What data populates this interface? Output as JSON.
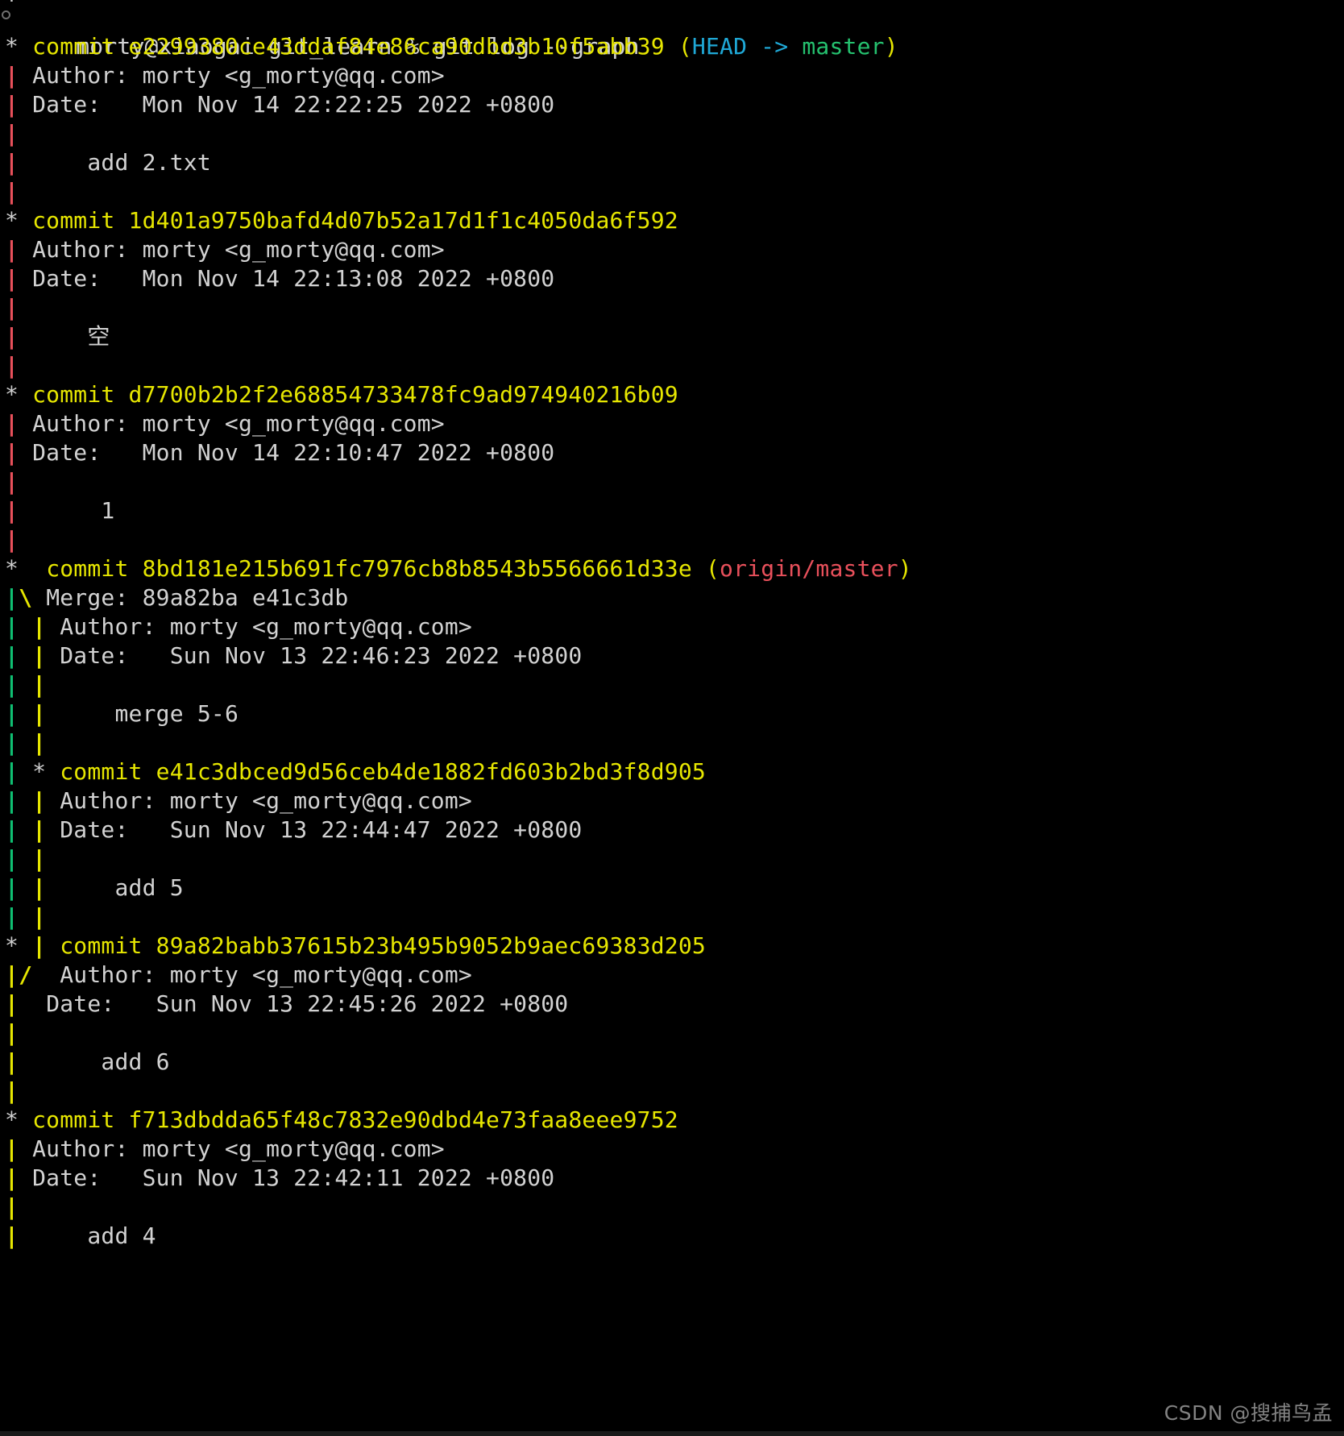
{
  "terminal": {
    "background_color": "#000000",
    "foreground_color": "#d2d2d2",
    "top_partial_line": "|",
    "prompt": {
      "bullet_icon": "circle-bullet-icon",
      "text": "morty@xiaogai git_learn % git log --graph"
    },
    "colors": {
      "commit_hash": "#e6e600",
      "head_ref": "#1fa8d6",
      "branch_ref": "#25c16f",
      "remote_ref": "#e8505b",
      "graph_red": "#e8505b",
      "graph_green": "#0fbf72",
      "graph_yellow": "#e6e600",
      "text": "#d2d2d2"
    }
  },
  "lines": [
    {
      "gutter": [
        {
          "t": "*",
          "c": "star"
        },
        {
          "t": " ",
          "c": "txt"
        }
      ],
      "segments": [
        {
          "t": "commit e2299380ce43ddaf84e86ca90dbd3b10f5abb39 ",
          "c": "yellow"
        },
        {
          "t": "(",
          "c": "yellow"
        },
        {
          "t": "HEAD -> ",
          "c": "cyan"
        },
        {
          "t": "master",
          "c": "green"
        },
        {
          "t": ")",
          "c": "yellow"
        }
      ]
    },
    {
      "gutter": [
        {
          "t": "|",
          "c": "g-red"
        },
        {
          "t": " ",
          "c": "txt"
        }
      ],
      "segments": [
        {
          "t": "Author: morty <g_morty@qq.com>",
          "c": "txt"
        }
      ]
    },
    {
      "gutter": [
        {
          "t": "|",
          "c": "g-red"
        },
        {
          "t": " ",
          "c": "txt"
        }
      ],
      "segments": [
        {
          "t": "Date:   Mon Nov 14 22:22:25 2022 +0800",
          "c": "txt"
        }
      ]
    },
    {
      "gutter": [
        {
          "t": "|",
          "c": "g-red"
        },
        {
          "t": " ",
          "c": "txt"
        }
      ],
      "segments": [
        {
          "t": "",
          "c": "txt"
        }
      ]
    },
    {
      "gutter": [
        {
          "t": "|",
          "c": "g-red"
        },
        {
          "t": " ",
          "c": "txt"
        }
      ],
      "segments": [
        {
          "t": "    add 2.txt",
          "c": "txt"
        }
      ]
    },
    {
      "gutter": [
        {
          "t": "|",
          "c": "g-red"
        },
        {
          "t": " ",
          "c": "txt"
        }
      ],
      "segments": [
        {
          "t": "",
          "c": "txt"
        }
      ]
    },
    {
      "gutter": [
        {
          "t": "*",
          "c": "star"
        },
        {
          "t": " ",
          "c": "txt"
        }
      ],
      "segments": [
        {
          "t": "commit 1d401a9750bafd4d07b52a17d1f1c4050da6f592",
          "c": "yellow"
        }
      ]
    },
    {
      "gutter": [
        {
          "t": "|",
          "c": "g-red"
        },
        {
          "t": " ",
          "c": "txt"
        }
      ],
      "segments": [
        {
          "t": "Author: morty <g_morty@qq.com>",
          "c": "txt"
        }
      ]
    },
    {
      "gutter": [
        {
          "t": "|",
          "c": "g-red"
        },
        {
          "t": " ",
          "c": "txt"
        }
      ],
      "segments": [
        {
          "t": "Date:   Mon Nov 14 22:13:08 2022 +0800",
          "c": "txt"
        }
      ]
    },
    {
      "gutter": [
        {
          "t": "|",
          "c": "g-red"
        },
        {
          "t": " ",
          "c": "txt"
        }
      ],
      "segments": [
        {
          "t": "",
          "c": "txt"
        }
      ]
    },
    {
      "gutter": [
        {
          "t": "|",
          "c": "g-red"
        },
        {
          "t": " ",
          "c": "txt"
        }
      ],
      "segments": [
        {
          "t": "    空",
          "c": "txt"
        }
      ]
    },
    {
      "gutter": [
        {
          "t": "|",
          "c": "g-red"
        },
        {
          "t": " ",
          "c": "txt"
        }
      ],
      "segments": [
        {
          "t": "",
          "c": "txt"
        }
      ]
    },
    {
      "gutter": [
        {
          "t": "*",
          "c": "star"
        },
        {
          "t": " ",
          "c": "txt"
        }
      ],
      "segments": [
        {
          "t": "commit d7700b2b2f2e68854733478fc9ad974940216b09",
          "c": "yellow"
        }
      ]
    },
    {
      "gutter": [
        {
          "t": "|",
          "c": "g-red"
        },
        {
          "t": " ",
          "c": "txt"
        }
      ],
      "segments": [
        {
          "t": "Author: morty <g_morty@qq.com>",
          "c": "txt"
        }
      ]
    },
    {
      "gutter": [
        {
          "t": "|",
          "c": "g-red"
        },
        {
          "t": " ",
          "c": "txt"
        }
      ],
      "segments": [
        {
          "t": "Date:   Mon Nov 14 22:10:47 2022 +0800",
          "c": "txt"
        }
      ]
    },
    {
      "gutter": [
        {
          "t": "|",
          "c": "g-red"
        },
        {
          "t": " ",
          "c": "txt"
        }
      ],
      "segments": [
        {
          "t": "",
          "c": "txt"
        }
      ]
    },
    {
      "gutter": [
        {
          "t": "|",
          "c": "g-red"
        },
        {
          "t": " ",
          "c": "txt"
        }
      ],
      "segments": [
        {
          "t": "     1",
          "c": "txt"
        }
      ]
    },
    {
      "gutter": [
        {
          "t": "|",
          "c": "g-red"
        },
        {
          "t": " ",
          "c": "txt"
        }
      ],
      "segments": [
        {
          "t": "",
          "c": "txt"
        }
      ]
    },
    {
      "gutter": [
        {
          "t": "*",
          "c": "star"
        },
        {
          "t": "  ",
          "c": "txt"
        }
      ],
      "segments": [
        {
          "t": "commit 8bd181e215b691fc7976cb8b8543b5566661d33e ",
          "c": "yellow"
        },
        {
          "t": "(",
          "c": "yellow"
        },
        {
          "t": "origin/master",
          "c": "red"
        },
        {
          "t": ")",
          "c": "yellow"
        }
      ]
    },
    {
      "gutter": [
        {
          "t": "|",
          "c": "g-green"
        },
        {
          "t": "\\",
          "c": "g-yellow"
        },
        {
          "t": " ",
          "c": "txt"
        }
      ],
      "segments": [
        {
          "t": "Merge: 89a82ba e41c3db",
          "c": "txt"
        }
      ]
    },
    {
      "gutter": [
        {
          "t": "|",
          "c": "g-green"
        },
        {
          "t": " ",
          "c": "txt"
        },
        {
          "t": "|",
          "c": "g-yellow"
        },
        {
          "t": " ",
          "c": "txt"
        }
      ],
      "segments": [
        {
          "t": "Author: morty <g_morty@qq.com>",
          "c": "txt"
        }
      ]
    },
    {
      "gutter": [
        {
          "t": "|",
          "c": "g-green"
        },
        {
          "t": " ",
          "c": "txt"
        },
        {
          "t": "|",
          "c": "g-yellow"
        },
        {
          "t": " ",
          "c": "txt"
        }
      ],
      "segments": [
        {
          "t": "Date:   Sun Nov 13 22:46:23 2022 +0800",
          "c": "txt"
        }
      ]
    },
    {
      "gutter": [
        {
          "t": "|",
          "c": "g-green"
        },
        {
          "t": " ",
          "c": "txt"
        },
        {
          "t": "|",
          "c": "g-yellow"
        },
        {
          "t": " ",
          "c": "txt"
        }
      ],
      "segments": [
        {
          "t": "",
          "c": "txt"
        }
      ]
    },
    {
      "gutter": [
        {
          "t": "|",
          "c": "g-green"
        },
        {
          "t": " ",
          "c": "txt"
        },
        {
          "t": "|",
          "c": "g-yellow"
        },
        {
          "t": " ",
          "c": "txt"
        }
      ],
      "segments": [
        {
          "t": "    merge 5-6",
          "c": "txt"
        }
      ]
    },
    {
      "gutter": [
        {
          "t": "|",
          "c": "g-green"
        },
        {
          "t": " ",
          "c": "txt"
        },
        {
          "t": "|",
          "c": "g-yellow"
        },
        {
          "t": " ",
          "c": "txt"
        }
      ],
      "segments": [
        {
          "t": "",
          "c": "txt"
        }
      ]
    },
    {
      "gutter": [
        {
          "t": "|",
          "c": "g-green"
        },
        {
          "t": " ",
          "c": "txt"
        },
        {
          "t": "*",
          "c": "star"
        },
        {
          "t": " ",
          "c": "txt"
        }
      ],
      "segments": [
        {
          "t": "commit e41c3dbced9d56ceb4de1882fd603b2bd3f8d905",
          "c": "yellow"
        }
      ]
    },
    {
      "gutter": [
        {
          "t": "|",
          "c": "g-green"
        },
        {
          "t": " ",
          "c": "txt"
        },
        {
          "t": "|",
          "c": "g-yellow"
        },
        {
          "t": " ",
          "c": "txt"
        }
      ],
      "segments": [
        {
          "t": "Author: morty <g_morty@qq.com>",
          "c": "txt"
        }
      ]
    },
    {
      "gutter": [
        {
          "t": "|",
          "c": "g-green"
        },
        {
          "t": " ",
          "c": "txt"
        },
        {
          "t": "|",
          "c": "g-yellow"
        },
        {
          "t": " ",
          "c": "txt"
        }
      ],
      "segments": [
        {
          "t": "Date:   Sun Nov 13 22:44:47 2022 +0800",
          "c": "txt"
        }
      ]
    },
    {
      "gutter": [
        {
          "t": "|",
          "c": "g-green"
        },
        {
          "t": " ",
          "c": "txt"
        },
        {
          "t": "|",
          "c": "g-yellow"
        },
        {
          "t": " ",
          "c": "txt"
        }
      ],
      "segments": [
        {
          "t": "",
          "c": "txt"
        }
      ]
    },
    {
      "gutter": [
        {
          "t": "|",
          "c": "g-green"
        },
        {
          "t": " ",
          "c": "txt"
        },
        {
          "t": "|",
          "c": "g-yellow"
        },
        {
          "t": " ",
          "c": "txt"
        }
      ],
      "segments": [
        {
          "t": "    add 5",
          "c": "txt"
        }
      ]
    },
    {
      "gutter": [
        {
          "t": "|",
          "c": "g-green"
        },
        {
          "t": " ",
          "c": "txt"
        },
        {
          "t": "|",
          "c": "g-yellow"
        },
        {
          "t": " ",
          "c": "txt"
        }
      ],
      "segments": [
        {
          "t": "",
          "c": "txt"
        }
      ]
    },
    {
      "gutter": [
        {
          "t": "*",
          "c": "star"
        },
        {
          "t": " ",
          "c": "txt"
        },
        {
          "t": "|",
          "c": "g-yellow"
        },
        {
          "t": " ",
          "c": "txt"
        }
      ],
      "segments": [
        {
          "t": "commit 89a82babb37615b23b495b9052b9aec69383d205",
          "c": "yellow"
        }
      ]
    },
    {
      "gutter": [
        {
          "t": "|",
          "c": "g-yellow"
        },
        {
          "t": "/",
          "c": "g-yellow"
        },
        {
          "t": "  ",
          "c": "txt"
        }
      ],
      "segments": [
        {
          "t": "Author: morty <g_morty@qq.com>",
          "c": "txt"
        }
      ]
    },
    {
      "gutter": [
        {
          "t": "|",
          "c": "g-yellow"
        },
        {
          "t": "  ",
          "c": "txt"
        }
      ],
      "segments": [
        {
          "t": "Date:   Sun Nov 13 22:45:26 2022 +0800",
          "c": "txt"
        }
      ]
    },
    {
      "gutter": [
        {
          "t": "|",
          "c": "g-yellow"
        },
        {
          "t": " ",
          "c": "txt"
        }
      ],
      "segments": [
        {
          "t": "",
          "c": "txt"
        }
      ]
    },
    {
      "gutter": [
        {
          "t": "|",
          "c": "g-yellow"
        },
        {
          "t": "  ",
          "c": "txt"
        }
      ],
      "segments": [
        {
          "t": "    add 6",
          "c": "txt"
        }
      ]
    },
    {
      "gutter": [
        {
          "t": "|",
          "c": "g-yellow"
        },
        {
          "t": " ",
          "c": "txt"
        }
      ],
      "segments": [
        {
          "t": "",
          "c": "txt"
        }
      ]
    },
    {
      "gutter": [
        {
          "t": "*",
          "c": "star"
        },
        {
          "t": " ",
          "c": "txt"
        }
      ],
      "segments": [
        {
          "t": "commit f713dbdda65f48c7832e90dbd4e73faa8eee9752",
          "c": "yellow"
        }
      ]
    },
    {
      "gutter": [
        {
          "t": "|",
          "c": "g-yellow"
        },
        {
          "t": " ",
          "c": "txt"
        }
      ],
      "segments": [
        {
          "t": "Author: morty <g_morty@qq.com>",
          "c": "txt"
        }
      ]
    },
    {
      "gutter": [
        {
          "t": "|",
          "c": "g-yellow"
        },
        {
          "t": " ",
          "c": "txt"
        }
      ],
      "segments": [
        {
          "t": "Date:   Sun Nov 13 22:42:11 2022 +0800",
          "c": "txt"
        }
      ]
    },
    {
      "gutter": [
        {
          "t": "|",
          "c": "g-yellow"
        },
        {
          "t": " ",
          "c": "txt"
        }
      ],
      "segments": [
        {
          "t": "",
          "c": "txt"
        }
      ]
    },
    {
      "gutter": [
        {
          "t": "|",
          "c": "g-yellow"
        },
        {
          "t": " ",
          "c": "txt"
        }
      ],
      "segments": [
        {
          "t": "    add 4",
          "c": "txt"
        }
      ]
    }
  ],
  "watermark": {
    "text": "CSDN @搜捕鸟孟"
  }
}
